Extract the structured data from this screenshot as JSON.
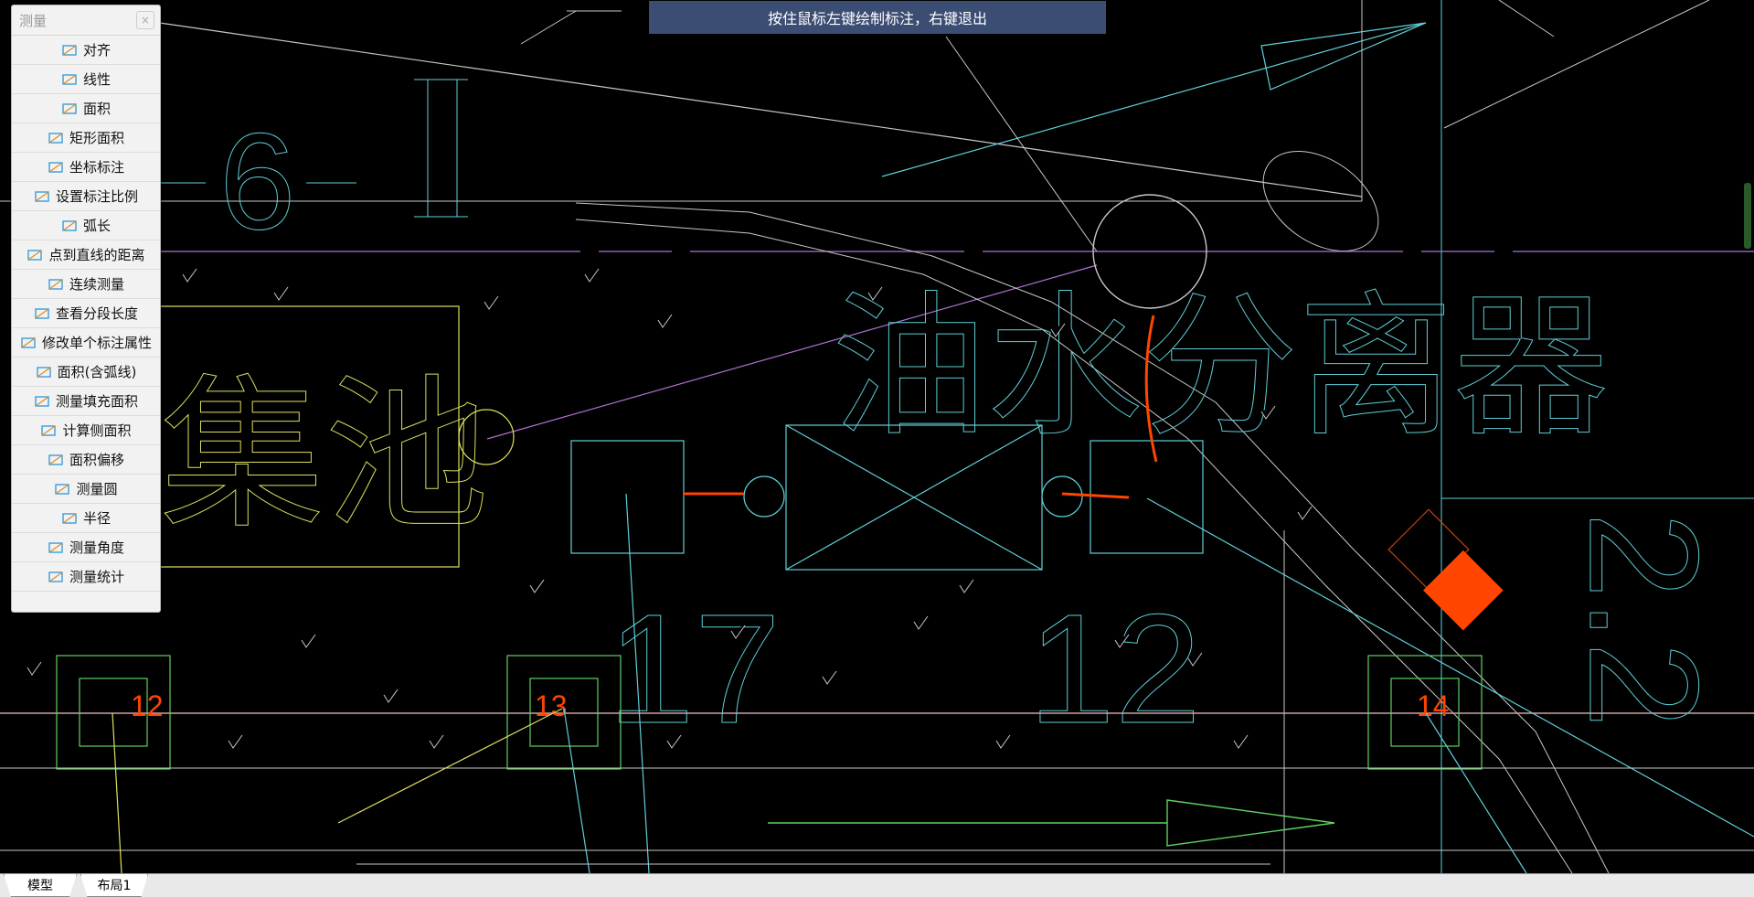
{
  "hint_bar": "按住鼠标左键绘制标注，右键退出",
  "panel": {
    "title": "测量",
    "close_symbol": "×",
    "items": [
      {
        "label": "对齐",
        "icon": "aligned-dimension-icon"
      },
      {
        "label": "线性",
        "icon": "linear-dimension-icon"
      },
      {
        "label": "面积",
        "icon": "area-icon"
      },
      {
        "label": "矩形面积",
        "icon": "rectangle-area-icon"
      },
      {
        "label": "坐标标注",
        "icon": "coordinate-icon"
      },
      {
        "label": "设置标注比例",
        "icon": "scale-icon"
      },
      {
        "label": "弧长",
        "icon": "arc-length-icon"
      },
      {
        "label": "点到直线的距离",
        "icon": "point-line-distance-icon"
      },
      {
        "label": "连续测量",
        "icon": "continuous-measure-icon"
      },
      {
        "label": "查看分段长度",
        "icon": "segment-length-icon"
      },
      {
        "label": "修改单个标注属性",
        "icon": "edit-dimension-icon"
      },
      {
        "label": "面积(含弧线)",
        "icon": "area-arc-icon"
      },
      {
        "label": "测量填充面积",
        "icon": "fill-area-icon"
      },
      {
        "label": "计算侧面积",
        "icon": "side-area-icon"
      },
      {
        "label": "面积偏移",
        "icon": "area-offset-icon"
      },
      {
        "label": "测量圆",
        "icon": "circle-measure-icon"
      },
      {
        "label": "半径",
        "icon": "radius-icon"
      },
      {
        "label": "测量角度",
        "icon": "angle-icon"
      },
      {
        "label": "测量统计",
        "icon": "statistics-icon"
      }
    ]
  },
  "drawing": {
    "text_6": "6",
    "pile_labels": [
      "12",
      "13",
      "14"
    ],
    "big_numbers": [
      "17",
      "12"
    ],
    "big_text": "油水分离器",
    "left_text": "集池",
    "right_number": "2.2",
    "colors": {
      "cyan": "#5fd0d8",
      "yellow": "#e0e060",
      "magenta": "#b070d0",
      "green": "#60d060",
      "orange": "#ff4500",
      "white": "#c8c8c8",
      "pink": "#d0a0a0"
    }
  },
  "tabs": [
    "模型",
    "布局1"
  ]
}
